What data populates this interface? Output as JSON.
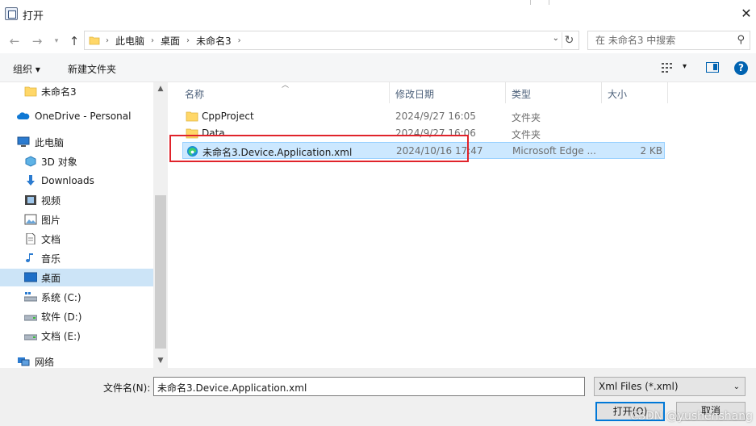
{
  "window": {
    "title": "打开",
    "close_glyph": "✕"
  },
  "address": {
    "crumbs": [
      "此电脑",
      "桌面",
      "未命名3"
    ],
    "search_placeholder": "在 未命名3 中搜索"
  },
  "toolbar": {
    "organize": "组织 ▾",
    "new_folder": "新建文件夹"
  },
  "navpane": {
    "items": [
      {
        "label": "未命名3",
        "icon": "folder-icon"
      },
      {
        "label": "OneDrive - Personal",
        "icon": "cloud-icon"
      },
      {
        "label": "此电脑",
        "icon": "computer-icon"
      },
      {
        "label": "3D 对象",
        "icon": "3d-objects-icon"
      },
      {
        "label": "Downloads",
        "icon": "download-icon"
      },
      {
        "label": "视频",
        "icon": "video-icon"
      },
      {
        "label": "图片",
        "icon": "picture-icon"
      },
      {
        "label": "文档",
        "icon": "document-icon"
      },
      {
        "label": "音乐",
        "icon": "music-icon"
      },
      {
        "label": "桌面",
        "icon": "desktop-icon",
        "selected": true
      },
      {
        "label": "系统 (C:)",
        "icon": "drive-c-icon"
      },
      {
        "label": "软件 (D:)",
        "icon": "drive-icon"
      },
      {
        "label": "文档 (E:)",
        "icon": "drive-icon"
      },
      {
        "label": "网络",
        "icon": "network-icon"
      }
    ]
  },
  "filelist": {
    "columns": [
      "名称",
      "修改日期",
      "类型",
      "大小"
    ],
    "rows": [
      {
        "name": "CppProject",
        "date": "2024/9/27 16:05",
        "type": "文件夹",
        "size": "",
        "icon": "folder-icon"
      },
      {
        "name": "Data",
        "date": "2024/9/27 16:06",
        "type": "文件夹",
        "size": "",
        "icon": "folder-icon"
      },
      {
        "name": "未命名3.Device.Application.xml",
        "date": "2024/10/16 17:47",
        "type": "Microsoft Edge ...",
        "size": "2 KB",
        "icon": "edge-icon",
        "selected": true
      }
    ]
  },
  "bottom": {
    "filename_label": "文件名(N):",
    "filename_value": "未命名3.Device.Application.xml",
    "filter_value": "Xml Files (*.xml)",
    "open_button": "打开(O)",
    "cancel_button": "取消"
  },
  "watermark": "CSDN @yushenshang",
  "colors": {
    "selection": "#cce8ff",
    "highlight_box": "#e0232b",
    "accent": "#0078d7"
  }
}
